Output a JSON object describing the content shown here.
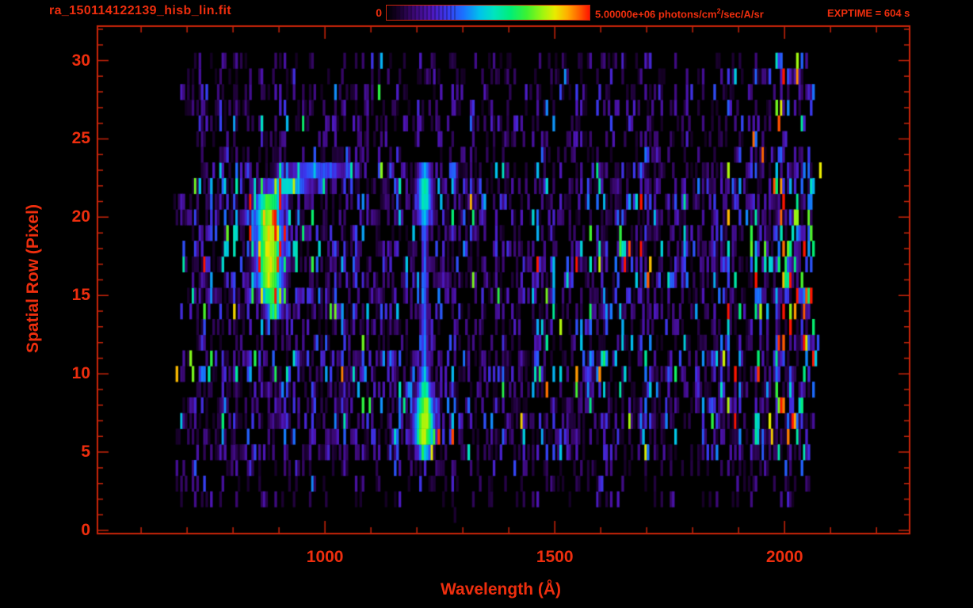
{
  "header": {
    "title": "ra_150114122139_hisb_lin.fit",
    "colorbar_min": "0",
    "colorbar_max_value": "5.00000e+06",
    "colorbar_units_pre": " photons/cm",
    "colorbar_units_sup": "2",
    "colorbar_units_post": "/sec/A/sr",
    "exptime": "EXPTIME = 604 s"
  },
  "colors": {
    "text_red": "#ee2e0e",
    "line_red": "#c9240a",
    "background": "#000000"
  },
  "chart_data": {
    "type": "heatmap",
    "title": "ra_150114122139_hisb_lin.fit",
    "xlabel": "Wavelength (Å)",
    "ylabel": "Spatial Row (Pixel)",
    "xlim": [
      505,
      2272
    ],
    "ylim": [
      -0.2,
      32.2
    ],
    "grid": false,
    "x_axis": {
      "major_ticks": [
        {
          "value": 1000,
          "label": "1000"
        },
        {
          "value": 1500,
          "label": "1500"
        },
        {
          "value": 2000,
          "label": "2000"
        }
      ],
      "minor_tick_step": 100,
      "minor_tick_range": [
        600,
        2200
      ]
    },
    "y_axis": {
      "major_ticks": [
        {
          "value": 0,
          "label": "0"
        },
        {
          "value": 5,
          "label": "5"
        },
        {
          "value": 10,
          "label": "10"
        },
        {
          "value": 15,
          "label": "15"
        },
        {
          "value": 20,
          "label": "20"
        },
        {
          "value": 25,
          "label": "25"
        },
        {
          "value": 30,
          "label": "30"
        }
      ],
      "minor_tick_step": 1,
      "minor_tick_range": [
        0,
        32
      ]
    },
    "colorbar": {
      "min": 0,
      "max": 5000000,
      "max_label": "5.00000e+06 photons/cm2/sec/A/sr",
      "colormap": "rainbow",
      "orientation": "horizontal"
    },
    "exposure_seconds": 604,
    "colormap_stops": [
      [
        0.0,
        0,
        0,
        0
      ],
      [
        0.05,
        20,
        0,
        35
      ],
      [
        0.13,
        58,
        8,
        112
      ],
      [
        0.22,
        78,
        22,
        185
      ],
      [
        0.3,
        58,
        58,
        240
      ],
      [
        0.38,
        25,
        115,
        255
      ],
      [
        0.46,
        0,
        195,
        235
      ],
      [
        0.53,
        0,
        228,
        190
      ],
      [
        0.61,
        0,
        238,
        120
      ],
      [
        0.69,
        60,
        242,
        50
      ],
      [
        0.77,
        160,
        245,
        15
      ],
      [
        0.83,
        232,
        235,
        0
      ],
      [
        0.89,
        255,
        175,
        0
      ],
      [
        0.95,
        255,
        95,
        0
      ],
      [
        1.0,
        255,
        20,
        0
      ]
    ],
    "image": {
      "description": "2D UV spectrogram: faint purple/blue striped noise with bright curved airglow arc near 880 A (rows 13-23), strong narrow Lyman-alpha emission line at 1216 A (rows 4-23, bright blob rows 5-9), and bright blue/cyan/green dense striping band 1880-2070 A",
      "lambda_data_range": [
        665,
        2072
      ],
      "row_data_range": [
        0,
        31
      ],
      "bin_angstrom": 5,
      "noise": {
        "seed": 1420139,
        "mean_level": 0.16,
        "row_gain": [
          0.03,
          0.08,
          0.3,
          0.45,
          0.5,
          0.68,
          0.72,
          0.78,
          0.78,
          0.72,
          0.95,
          0.85,
          0.6,
          0.72,
          0.8,
          0.85,
          0.8,
          0.85,
          0.8,
          0.75,
          0.8,
          0.85,
          0.78,
          0.68,
          0.58,
          0.52,
          0.6,
          0.52,
          0.6,
          0.5,
          0.42,
          0.02
        ],
        "row_skip": [
          0.93,
          0.88,
          0.6,
          0.52,
          0.5,
          0.34,
          0.32,
          0.3,
          0.3,
          0.32,
          0.26,
          0.3,
          0.36,
          0.32,
          0.3,
          0.3,
          0.3,
          0.3,
          0.3,
          0.32,
          0.3,
          0.3,
          0.32,
          0.34,
          0.46,
          0.48,
          0.44,
          0.48,
          0.44,
          0.48,
          0.5,
          0.95
        ]
      },
      "features": {
        "arc": {
          "name": "airglow-arc",
          "points_row_lambda_sigma_amp": [
            [
              13.6,
              888,
              12,
              0.44
            ],
            [
              14.4,
              884,
              16,
              0.66
            ],
            [
              15.4,
              880,
              19,
              0.82
            ],
            [
              16.4,
              877,
              20,
              0.88
            ],
            [
              17.4,
              876,
              20,
              0.92
            ],
            [
              18.4,
              877,
              20,
              0.92
            ],
            [
              19.4,
              876,
              20,
              0.88
            ],
            [
              20.4,
              872,
              20,
              0.82
            ],
            [
              21.2,
              878,
              22,
              0.72
            ],
            [
              21.8,
              902,
              30,
              0.6
            ],
            [
              22.5,
              948,
              46,
              0.48
            ],
            [
              23.2,
              990,
              55,
              0.32
            ]
          ]
        },
        "emission_line": {
          "name": "lyman-alpha-line",
          "lambda_center": 1214,
          "segments_rowlo_rowhi_amp_sigma": [
            [
              4.2,
              5.0,
              0.5,
              12
            ],
            [
              5.0,
              5.8,
              0.8,
              15
            ],
            [
              5.8,
              7.4,
              0.85,
              16
            ],
            [
              7.4,
              8.2,
              0.8,
              14
            ],
            [
              8.2,
              9.0,
              0.62,
              11
            ],
            [
              9.0,
              10.0,
              0.5,
              8
            ],
            [
              10.0,
              13.0,
              0.42,
              5
            ],
            [
              13.0,
              19.4,
              0.4,
              4.5
            ],
            [
              19.4,
              20.4,
              0.5,
              9
            ],
            [
              20.4,
              22.6,
              0.6,
              12
            ],
            [
              22.6,
              23.6,
              0.45,
              11
            ]
          ]
        },
        "long_wavelength_band": {
          "name": "bright-striping-band",
          "lambda_start": 1880,
          "gain_max": 2.6,
          "spike_probability": 0.03
        }
      }
    }
  }
}
